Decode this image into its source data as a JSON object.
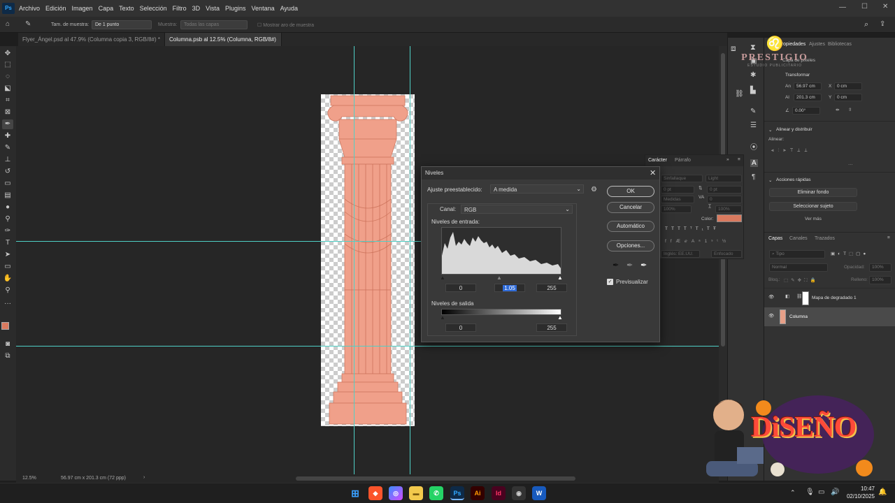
{
  "app": {
    "logo_text": "Ps"
  },
  "menu": [
    "Archivo",
    "Edición",
    "Imagen",
    "Capa",
    "Texto",
    "Selección",
    "Filtro",
    "3D",
    "Vista",
    "Plugins",
    "Ventana",
    "Ayuda"
  ],
  "options": {
    "sample_size_label": "Tam. de muestra:",
    "sample_size_value": "De 1 punto",
    "sample_label": "Muestra:",
    "sample_value": "Todas las capas",
    "show_ring": "Mostrar aro de muestra"
  },
  "tabs": [
    {
      "label": "Flyer_Ángel.psd al 47.9% (Columna copia 3, RGB/8#) *"
    },
    {
      "label": "Columna.psb al 12.5% (Columna, RGB/8#)"
    }
  ],
  "status": {
    "zoom": "12.5%",
    "doc_size": "56.97 cm x 201.3 cm (72 ppp)"
  },
  "props_panel": {
    "tabs": [
      "Propiedades",
      "Ajustes",
      "Bibliotecas"
    ],
    "layer_type": "Capa de píxeles",
    "transform_title": "Transformar",
    "an_label": "An",
    "an_value": "56.97 cm",
    "al_label": "Al",
    "al_value": "201.3 cm",
    "x_label": "X",
    "x_value": "0 cm",
    "y_label": "Y",
    "y_value": "0 cm",
    "angle": "0.00°",
    "align_title": "Alinear y distribuir",
    "align_label": "Alinear:",
    "quick_title": "Acciones rápidas",
    "remove_bg": "Eliminar fondo",
    "select_subject": "Seleccionar sujeto",
    "see_more": "Ver más"
  },
  "char_panel": {
    "tabs": [
      "Carácter",
      "Párrafo"
    ],
    "font": "Sinfallaque",
    "style": "Light",
    "size": "0 pt",
    "leading": "0 pt",
    "kerning": "Medidas",
    "tracking": "0",
    "scale_v": "100%",
    "scale_h": "100%",
    "color_label": "Color:",
    "color_value": "#d97a5f",
    "lang": "Inglés: EE.UU.",
    "antialias": "Enfocado"
  },
  "layers_panel": {
    "tabs": [
      "Capas",
      "Canales",
      "Trazados"
    ],
    "search_placeholder": "Tipo",
    "blend_mode": "Normal",
    "opacity_label": "Opacidad:",
    "opacity_value": "100%",
    "lock_label": "Bloq.:",
    "fill_label": "Relleno:",
    "fill_value": "100%",
    "layers": [
      {
        "name": "Mapa de degradado 1",
        "selected": false
      },
      {
        "name": "Columna",
        "selected": true
      }
    ]
  },
  "dialog": {
    "title": "Niveles",
    "preset_label": "Ajuste preestablecido:",
    "preset_value": "A medida",
    "channel_label": "Canal:",
    "channel_value": "RGB",
    "input_label": "Niveles de entrada:",
    "input_black": "0",
    "input_gamma": "1.05",
    "input_white": "255",
    "output_label": "Niveles de salida",
    "output_black": "0",
    "output_white": "255",
    "ok": "OK",
    "cancel": "Cancelar",
    "auto": "Automático",
    "options": "Opciones...",
    "preview_label": "Previsualizar",
    "preview_checked": true
  },
  "watermark": {
    "brand": "PRESTIGIO",
    "tagline": "ESTUDIO PUBLICITARIO",
    "sticker": "DiSEÑO"
  },
  "taskbar": {
    "apps": [
      "Windows",
      "Brave",
      "Copilot",
      "Explorador",
      "WhatsApp",
      "Photoshop",
      "Illustrator",
      "InDesign",
      "Chrome",
      "Word"
    ],
    "time": "10:47",
    "date": "02/10/2025"
  }
}
